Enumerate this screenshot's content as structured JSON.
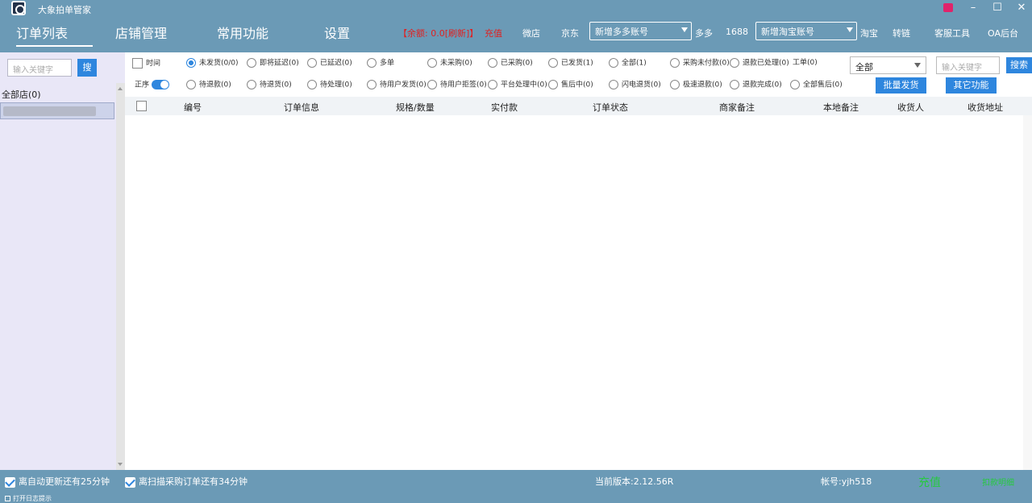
{
  "app": {
    "title": "大象拍单管家"
  },
  "header": {
    "tabs": [
      "订单列表",
      "店铺管理",
      "常用功能",
      "设置"
    ],
    "balance": "【余额: 0.0[刷新]】",
    "recharge": "充值",
    "links": {
      "weidian": "微店",
      "jd": "京东",
      "duoduo": "多多",
      "s1688": "1688",
      "taobao": "淘宝",
      "zhuanlian": "转链",
      "kefu": "客服工具",
      "oa": "OA后台"
    },
    "add_pdd": "新增多多账号",
    "add_taobao": "新增淘宝账号"
  },
  "sidebar": {
    "search_placeholder": "输入关键字",
    "search_btn": "搜",
    "all_shops": "全部店(0)"
  },
  "filters": {
    "time": "时间",
    "order_asc": "正序",
    "row1": [
      "未发货(0/0)",
      "即将延迟(0)",
      "已延迟(0)",
      "多单",
      "未采购(0)",
      "已采购(0)",
      "已发货(1)",
      "全部(1)",
      "采购未付款(0)",
      "退款已处理(0)"
    ],
    "ticket": "工单(0)",
    "row2": [
      "待退款(0)",
      "待退货(0)",
      "待处理(0)",
      "待用户发货(0)",
      "待用户拒签(0)",
      "平台处理中(0)",
      "售后中(0)",
      "闪电退货(0)",
      "极速退款(0)",
      "退款完成(0)",
      "全部售后(0)"
    ],
    "select_value": "全部",
    "search_placeholder": "输入关键字",
    "search_btn": "搜索",
    "batch_ship": "批量发货",
    "other": "其它功能"
  },
  "table": {
    "headers": [
      "编号",
      "订单信息",
      "规格/数量",
      "实付款",
      "订单状态",
      "商家备注",
      "本地备注",
      "收货人",
      "收货地址"
    ]
  },
  "footer": {
    "auto_update": "离自动更新还有25分钟",
    "scan": "离扫描采购订单还有34分钟",
    "log": "打开日志提示",
    "version": "当前版本:2.12.56R",
    "account": "帐号:yjh518",
    "recharge": "充值",
    "detail": "扣款明细"
  }
}
